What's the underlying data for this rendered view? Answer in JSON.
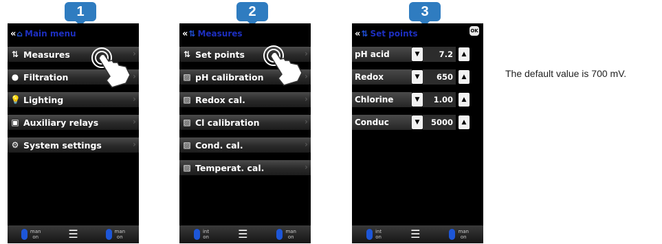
{
  "steps": [
    {
      "badge": "1",
      "header": {
        "title": "Main menu"
      },
      "menu": [
        {
          "icon": "measures-icon",
          "glyph": "⇅",
          "label": "Measures"
        },
        {
          "icon": "filtration-icon",
          "glyph": "●",
          "label": "Filtration"
        },
        {
          "icon": "lighting-icon",
          "glyph": "💡",
          "label": "Lighting"
        },
        {
          "icon": "relay-icon",
          "glyph": "▣",
          "label": "Auxiliary relays"
        },
        {
          "icon": "settings-icon",
          "glyph": "⚙",
          "label": "System settings"
        }
      ],
      "footer": {
        "left_top": "man",
        "left_bottom": "on",
        "right_top": "man",
        "right_bottom": "on"
      }
    },
    {
      "badge": "2",
      "header": {
        "title": "Measures"
      },
      "menu": [
        {
          "icon": "measures-icon",
          "glyph": "⇅",
          "label": "Set points"
        },
        {
          "icon": "calibration-icon",
          "glyph": "▨",
          "label": "pH calibration"
        },
        {
          "icon": "calibration-icon",
          "glyph": "▨",
          "label": "Redox cal."
        },
        {
          "icon": "calibration-icon",
          "glyph": "▨",
          "label": "Cl calibration"
        },
        {
          "icon": "calibration-icon",
          "glyph": "▨",
          "label": "Cond. cal."
        },
        {
          "icon": "calibration-icon",
          "glyph": "▨",
          "label": "Temperat. cal."
        }
      ],
      "footer": {
        "left_top": "int",
        "left_bottom": "on",
        "right_top": "man",
        "right_bottom": "on"
      }
    },
    {
      "badge": "3",
      "header": {
        "title": "Set points",
        "ok": "OK"
      },
      "setpoints": [
        {
          "label": "pH acid",
          "value": "7.2"
        },
        {
          "label": "Redox",
          "value": "650"
        },
        {
          "label": "Chlorine",
          "value": "1.00"
        },
        {
          "label": "Conduc",
          "value": "5000"
        }
      ],
      "footer": {
        "left_top": "int",
        "left_bottom": "on",
        "right_top": "man",
        "right_bottom": "on"
      }
    }
  ],
  "note": "The default value is 700 mV."
}
